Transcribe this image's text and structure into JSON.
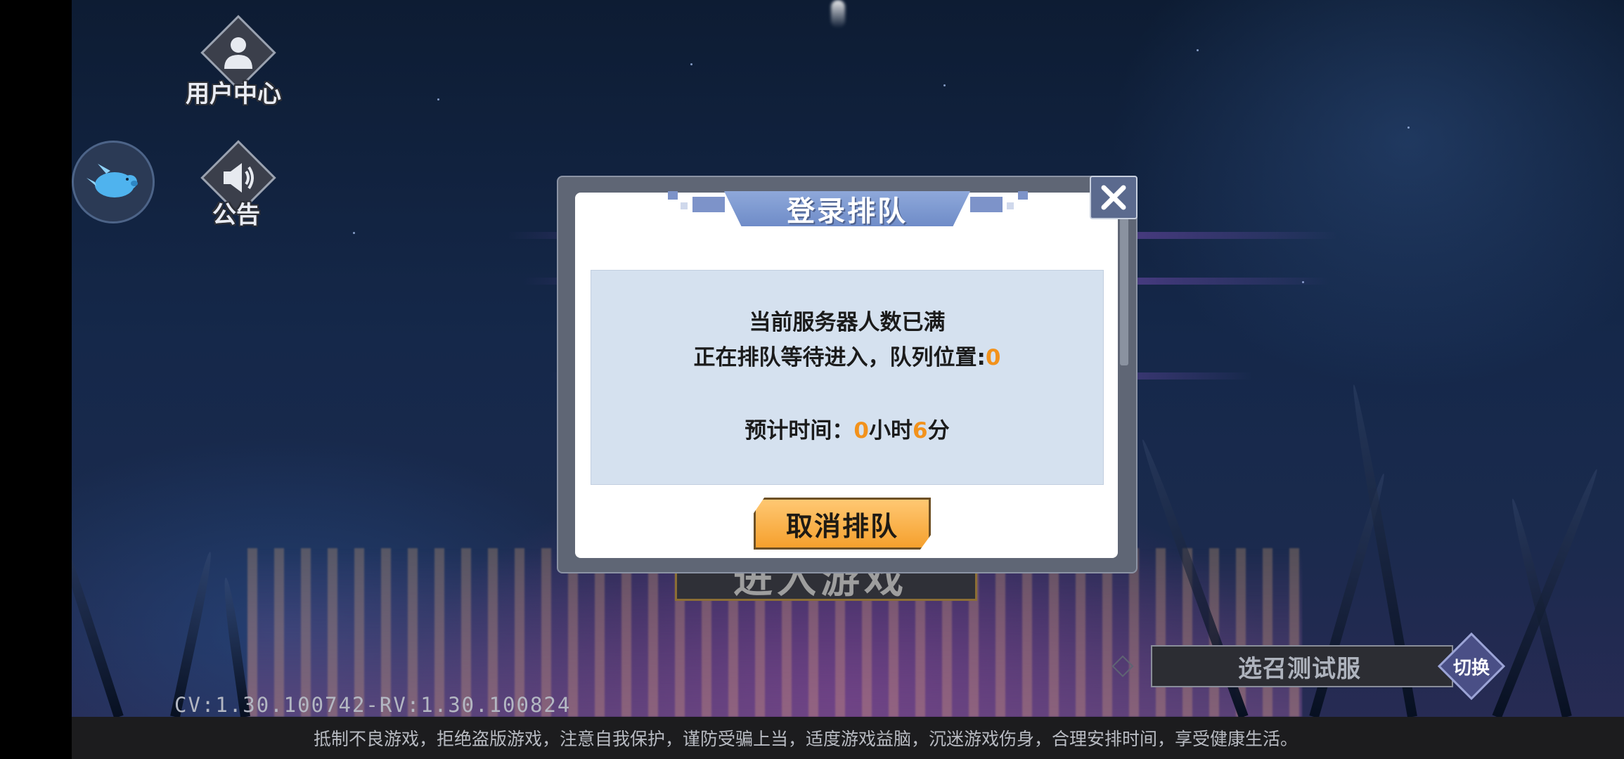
{
  "top_icons": {
    "user_center_label": "用户中心",
    "announcement_label": "公告"
  },
  "dialog": {
    "title": "登录排队",
    "line1": "当前服务器人数已满",
    "line2_prefix": "正在排队等待进入，队列位置:",
    "queue_position": "0",
    "time_prefix": "预计时间：",
    "hours": "0",
    "hours_unit": "小时",
    "minutes": "6",
    "minutes_unit": "分",
    "cancel_label": "取消排队"
  },
  "background": {
    "enter_game_label": "进入游戏"
  },
  "server": {
    "name": "选召测试服",
    "switch_label": "切换"
  },
  "version": "CV:1.30.100742-RV:1.30.100824",
  "footer_notice": "抵制不良游戏，拒绝盗版游戏，注意自我保护，谨防受骗上当，适度游戏益脑，沉迷游戏伤身，合理安排时间，享受健康生活。",
  "colors": {
    "highlight": "#f2921c",
    "title_banner": "#7f9ad2",
    "cancel_button": "#f5a02d"
  }
}
